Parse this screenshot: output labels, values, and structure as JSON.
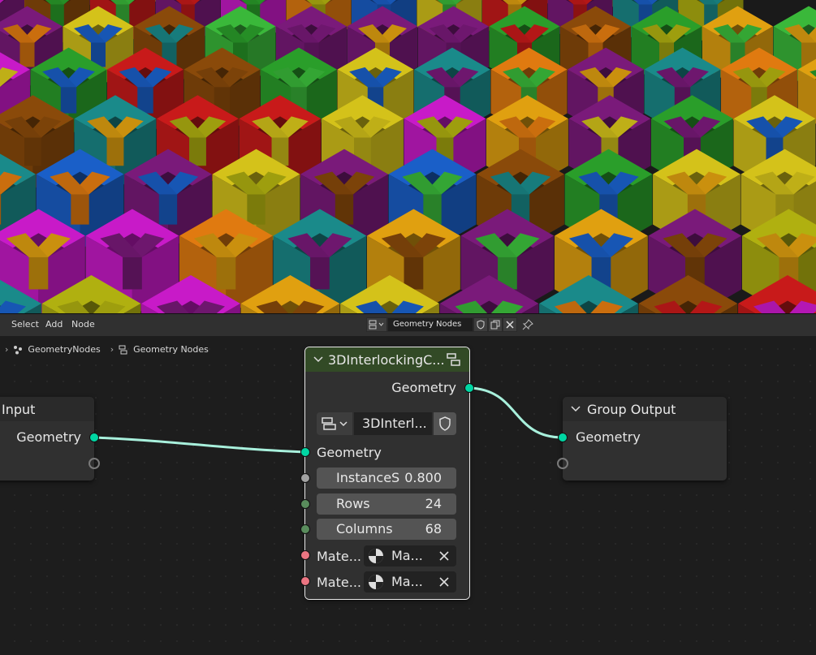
{
  "header": {
    "menus": [
      "Select",
      "Add",
      "Node"
    ],
    "tree_name": "Geometry Nodes",
    "shield_icon": "fake-user-shield-icon",
    "duplicate_icon": "duplicate-icon",
    "close_icon": "close-icon",
    "pin_icon": "pin-icon"
  },
  "breadcrumb": {
    "object": "GeometryNodes",
    "tree": "Geometry Nodes"
  },
  "nodes": {
    "group_input": {
      "title": "Input",
      "output_label": "Geometry"
    },
    "group_node": {
      "title": "3DInterlockingC...",
      "output_label": "Geometry",
      "tree_name": "3DInterl...",
      "geometry_label": "Geometry",
      "inputs": [
        {
          "label": "InstanceS",
          "value": "0.800"
        },
        {
          "label": "Rows",
          "value": "24"
        },
        {
          "label": "Columns",
          "value": "68"
        }
      ],
      "materials": [
        {
          "label": "Mate...",
          "value": "Ma..."
        },
        {
          "label": "Mate...",
          "value": "Ma..."
        }
      ]
    },
    "group_output": {
      "title": "Group Output",
      "input_label": "Geometry"
    }
  },
  "colors": {
    "geometry_socket": "#00d6a3",
    "float_socket": "#a1a1a1",
    "int_socket": "#598c5c",
    "material_socket": "#eb7582",
    "group_header": "#324a26",
    "output_header": "#2a2a2a",
    "link": "#a8f0dc"
  }
}
